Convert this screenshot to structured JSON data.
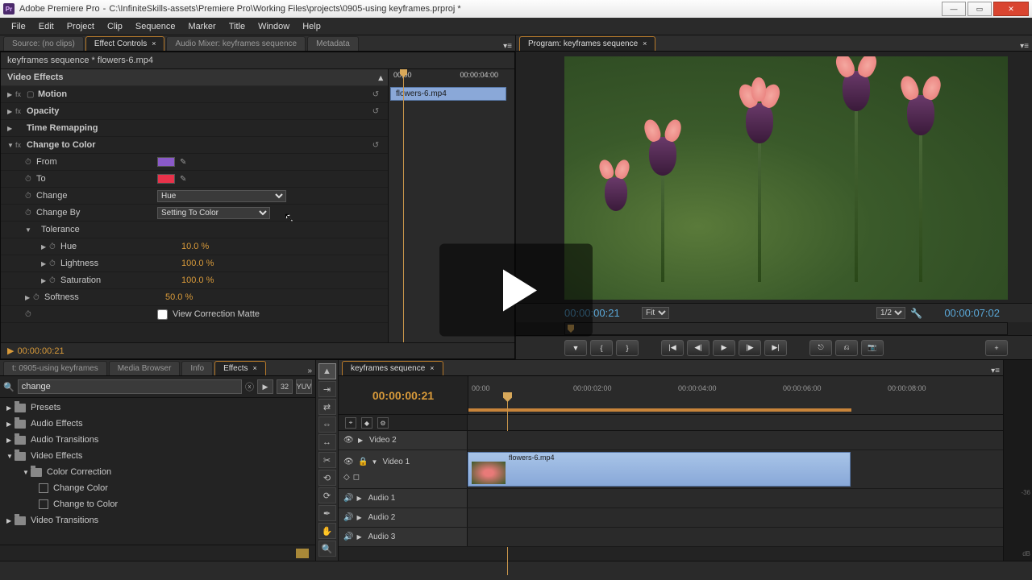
{
  "titlebar": {
    "app": "Adobe Premiere Pro",
    "path": "C:\\InfiniteSkills-assets\\Premiere Pro\\Working Files\\projects\\0905-using keyframes.prproj *"
  },
  "menu": [
    "File",
    "Edit",
    "Project",
    "Clip",
    "Sequence",
    "Marker",
    "Title",
    "Window",
    "Help"
  ],
  "source_tab": "Source: (no clips)",
  "ec_tabs": [
    "Effect Controls",
    "Audio Mixer: keyframes sequence",
    "Metadata"
  ],
  "ec": {
    "breadcrumb": "keyframes sequence * flowers-6.mp4",
    "head_tc": "00:00:04:00",
    "video_effects": "Video Effects",
    "motion": "Motion",
    "opacity": "Opacity",
    "time_remap": "Time Remapping",
    "change_color": "Change to Color",
    "from": "From",
    "to": "To",
    "change": "Change",
    "change_val": "Hue",
    "change_by": "Change By",
    "change_by_val": "Setting To Color",
    "tolerance": "Tolerance",
    "hue": "Hue",
    "hue_v": "10.0 %",
    "light": "Lightness",
    "light_v": "100.0 %",
    "sat": "Saturation",
    "sat_v": "100.0 %",
    "soft": "Softness",
    "soft_v": "50.0 %",
    "view_matte": "View Correction Matte",
    "clip_label": "flowers-6.mp4",
    "from_color": "#8a5ac8",
    "to_color": "#e8324a",
    "footer_tc": "00:00:00:21"
  },
  "program": {
    "tab": "Program: keyframes sequence",
    "tc_left": "00:00:00:21",
    "fit": "Fit",
    "zoom": "1/2",
    "tc_right": "00:00:07:02"
  },
  "effects_panel": {
    "tabs": [
      "t: 0905-using keyframes",
      "Media Browser",
      "Info",
      "Effects"
    ],
    "search": "change",
    "tree": {
      "presets": "Presets",
      "audio_fx": "Audio Effects",
      "audio_tr": "Audio Transitions",
      "video_fx": "Video Effects",
      "color_corr": "Color Correction",
      "change_color": "Change Color",
      "change_to_color": "Change to Color",
      "video_tr": "Video Transitions"
    }
  },
  "timeline": {
    "tab": "keyframes sequence",
    "tc": "00:00:00:21",
    "ticks": [
      "00:00",
      "00:00:02:00",
      "00:00:04:00",
      "00:00:06:00",
      "00:00:08:00"
    ],
    "tracks": {
      "v2": "Video 2",
      "v1": "Video 1",
      "a1": "Audio 1",
      "a2": "Audio 2",
      "a3": "Audio 3"
    },
    "clip": "flowers-6.mp4"
  },
  "meters": {
    "m36": "-36",
    "db": "dB"
  }
}
